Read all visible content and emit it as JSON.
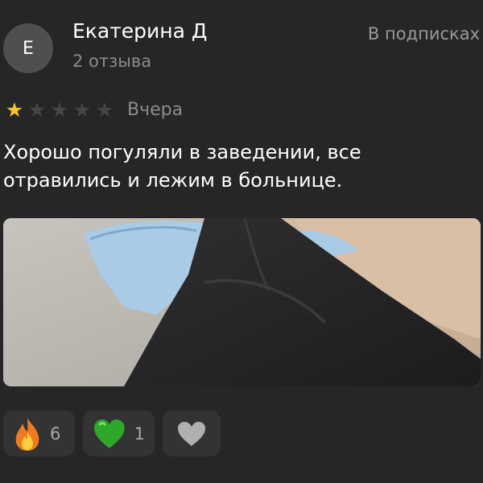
{
  "author": {
    "initial": "Е",
    "name": "Екатерина Д",
    "reviews_count": "2 отзыва",
    "subscription_status": "В подписках"
  },
  "rating": {
    "value": 1,
    "max": 5,
    "date": "Вчера"
  },
  "review": {
    "text": "Хорошо погуляли в заведении, все отравились и лежим в больнице."
  },
  "reactions": [
    {
      "icon": "fire-icon",
      "count": "6"
    },
    {
      "icon": "green-heart-icon",
      "count": "1"
    },
    {
      "icon": "heart-icon",
      "count": ""
    }
  ],
  "colors": {
    "background": "#262626",
    "star_filled": "#f5c233",
    "star_empty": "#454545",
    "muted_text": "#8c8c8c",
    "chip_background": "#333333"
  }
}
